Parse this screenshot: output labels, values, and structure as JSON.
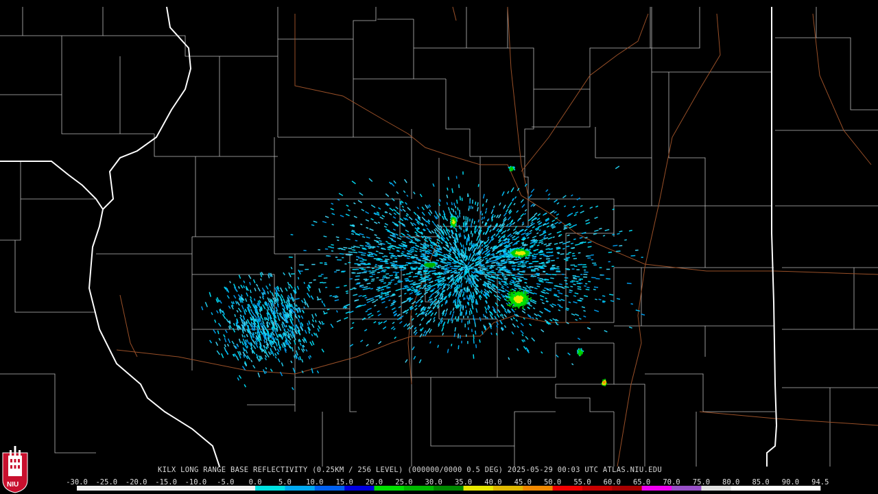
{
  "product": {
    "title": "KILX LONG RANGE BASE REFLECTIVITY (0.25KM / 256 LEVEL) (000000/0000 0.5 DEG) 2025-05-29 00:03 UTC  ATLAS.NIU.EDU",
    "radar_site": "KILX",
    "product_name": "LONG RANGE BASE REFLECTIVITY",
    "resolution": "0.25KM / 256 LEVEL",
    "elevation": "0.5 DEG",
    "datetime": "2025-05-29 00:03 UTC",
    "source": "ATLAS.NIU.EDU"
  },
  "logo": {
    "text": "NIU",
    "color": "#c8102e"
  },
  "color_scale": {
    "labels": [
      "-30.0",
      "-25.0",
      "-20.0",
      "-15.0",
      "-10.0",
      "-5.0",
      "0.0",
      "5.0",
      "10.0",
      "15.0",
      "20.0",
      "25.0",
      "30.0",
      "35.0",
      "40.0",
      "45.0",
      "50.0",
      "55.0",
      "60.0",
      "65.0",
      "70.0",
      "75.0",
      "80.0",
      "85.0",
      "90.0",
      "94.5"
    ],
    "colors": [
      "#f0f0f0",
      "#f0f0f0",
      "#f0f0f0",
      "#f0f0f0",
      "#f0f0f0",
      "#f0f0f0",
      "#00e0e0",
      "#00a8f0",
      "#0060f0",
      "#0000e0",
      "#00e000",
      "#00b800",
      "#008800",
      "#e8e800",
      "#e0b800",
      "#f08800",
      "#f00000",
      "#c80000",
      "#a80000",
      "#f000f0",
      "#9850c8",
      "#e0e0e0",
      "#ffffff",
      "#ffffff",
      "#ffffff"
    ]
  },
  "map": {
    "background": "#000000",
    "county_line_color": "#c8c8c8",
    "state_line_color": "#ffffff",
    "road_color": "#b05a30"
  }
}
